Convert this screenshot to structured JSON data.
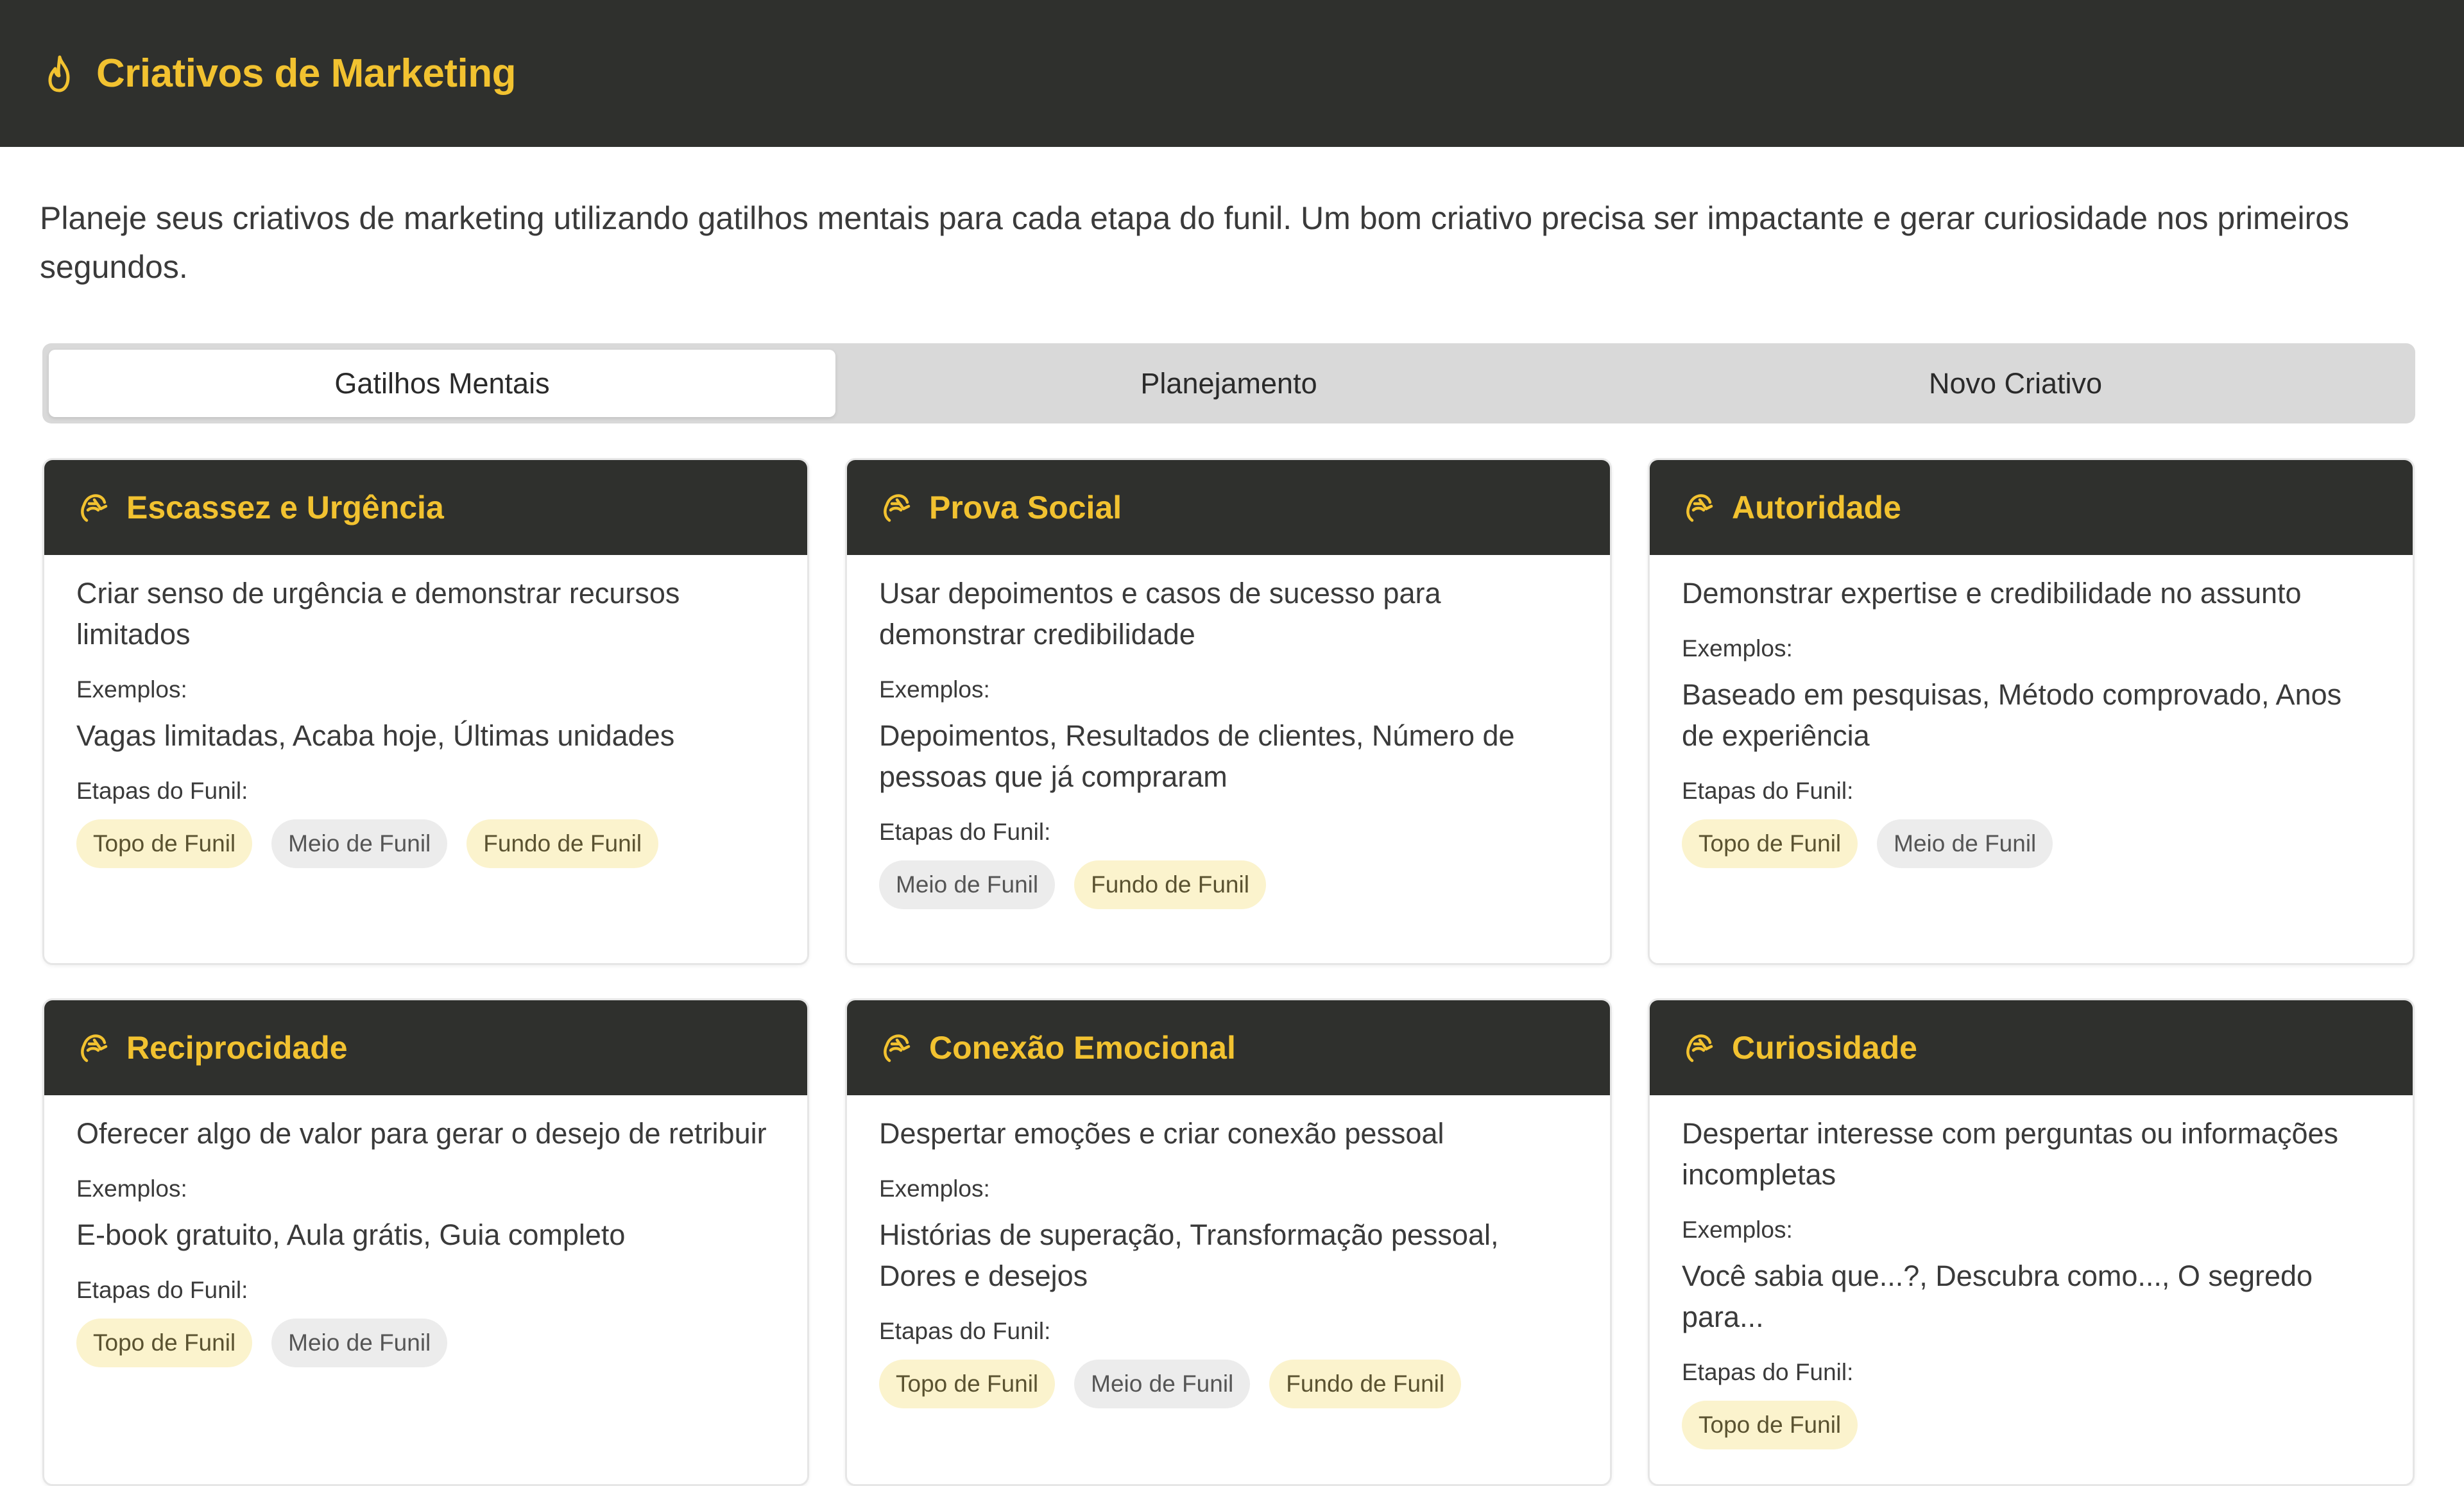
{
  "header": {
    "title": "Criativos de Marketing",
    "icon": "fire-icon",
    "accent_color": "#f2c230",
    "bg_color": "#2f302d"
  },
  "intro": "Planeje seus criativos de marketing utilizando gatilhos mentais para cada etapa do funil. Um bom criativo precisa ser impactante e gerar curiosidade nos primeiros segundos.",
  "tabs": [
    {
      "label": "Gatilhos Mentais",
      "active": true
    },
    {
      "label": "Planejamento",
      "active": false
    },
    {
      "label": "Novo Criativo",
      "active": false
    }
  ],
  "labels": {
    "examples": "Exemplos:",
    "stages": "Etapas do Funil:"
  },
  "cards": [
    {
      "title": "Escassez e Urgência",
      "description": "Criar senso de urgência e demonstrar recursos limitados",
      "examples": "Vagas limitadas, Acaba hoje, Últimas unidades",
      "stages": [
        {
          "label": "Topo de Funil",
          "color": "yellow"
        },
        {
          "label": "Meio de Funil",
          "color": "gray"
        },
        {
          "label": "Fundo de Funil",
          "color": "yellow"
        }
      ]
    },
    {
      "title": "Prova Social",
      "description": "Usar depoimentos e casos de sucesso para demonstrar credibilidade",
      "examples": "Depoimentos, Resultados de clientes, Número de pessoas que já compraram",
      "stages": [
        {
          "label": "Meio de Funil",
          "color": "gray"
        },
        {
          "label": "Fundo de Funil",
          "color": "yellow"
        }
      ]
    },
    {
      "title": "Autoridade",
      "description": "Demonstrar expertise e credibilidade no assunto",
      "examples": "Baseado em pesquisas, Método comprovado, Anos de experiência",
      "stages": [
        {
          "label": "Topo de Funil",
          "color": "yellow"
        },
        {
          "label": "Meio de Funil",
          "color": "gray"
        }
      ]
    },
    {
      "title": "Reciprocidade",
      "description": "Oferecer algo de valor para gerar o desejo de retribuir",
      "examples": "E-book gratuito, Aula grátis, Guia completo",
      "stages": [
        {
          "label": "Topo de Funil",
          "color": "yellow"
        },
        {
          "label": "Meio de Funil",
          "color": "gray"
        }
      ]
    },
    {
      "title": "Conexão Emocional",
      "description": "Despertar emoções e criar conexão pessoal",
      "examples": "Histórias de superação, Transformação pessoal, Dores e desejos",
      "stages": [
        {
          "label": "Topo de Funil",
          "color": "yellow"
        },
        {
          "label": "Meio de Funil",
          "color": "gray"
        },
        {
          "label": "Fundo de Funil",
          "color": "yellow"
        }
      ]
    },
    {
      "title": "Curiosidade",
      "description": "Despertar interesse com perguntas ou informações incompletas",
      "examples": "Você sabia que...?, Descubra como..., O segredo para...",
      "stages": [
        {
          "label": "Topo de Funil",
          "color": "yellow"
        }
      ]
    }
  ]
}
